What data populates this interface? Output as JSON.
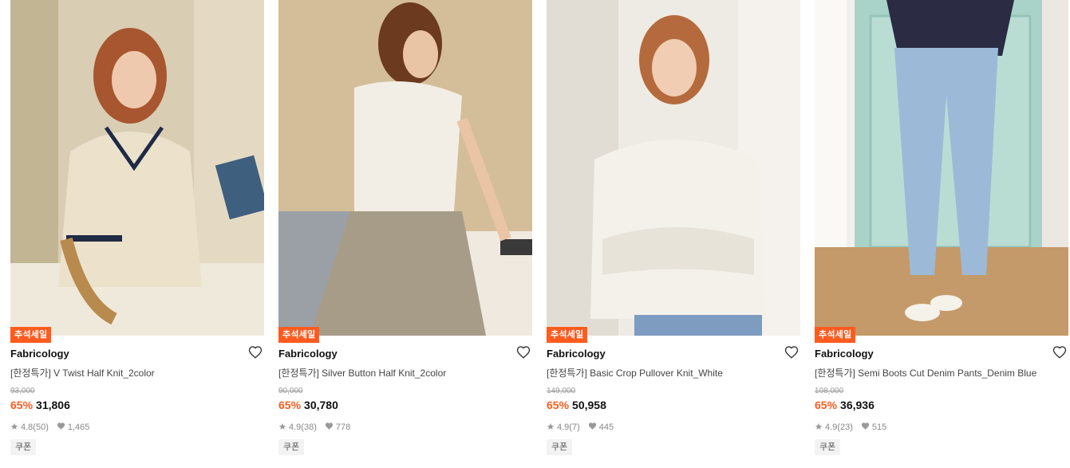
{
  "products": [
    {
      "badge": "추석세일",
      "brand": "Fabricology",
      "title": "[한정특가] V Twist Half Knit_2color",
      "original_price": "93,000",
      "discount": "65%",
      "price": "31,806",
      "rating": "4.8",
      "reviews": "(50)",
      "likes": "1,465",
      "coupon": "쿠폰"
    },
    {
      "badge": "추석세일",
      "brand": "Fabricology",
      "title": "[한정특가] Silver Button Half Knit_2color",
      "original_price": "90,000",
      "discount": "65%",
      "price": "30,780",
      "rating": "4.9",
      "reviews": "(38)",
      "likes": "778",
      "coupon": "쿠폰"
    },
    {
      "badge": "추석세일",
      "brand": "Fabricology",
      "title": "[한정특가] Basic Crop Pullover Knit_White",
      "original_price": "149,000",
      "discount": "65%",
      "price": "50,958",
      "rating": "4.9",
      "reviews": "(7)",
      "likes": "445",
      "coupon": "쿠폰"
    },
    {
      "badge": "추석세일",
      "brand": "Fabricology",
      "title": "[한정특가] Semi Boots Cut Denim Pants_Denim Blue",
      "original_price": "108,000",
      "discount": "65%",
      "price": "36,936",
      "rating": "4.9",
      "reviews": "(23)",
      "likes": "515",
      "coupon": "쿠폰"
    }
  ],
  "icons": {
    "wishlist": "heart-outline-icon",
    "rating": "star-icon",
    "likes": "heart-filled-icon"
  },
  "colors": {
    "accent": "#ff5b1f",
    "muted": "#888888"
  }
}
